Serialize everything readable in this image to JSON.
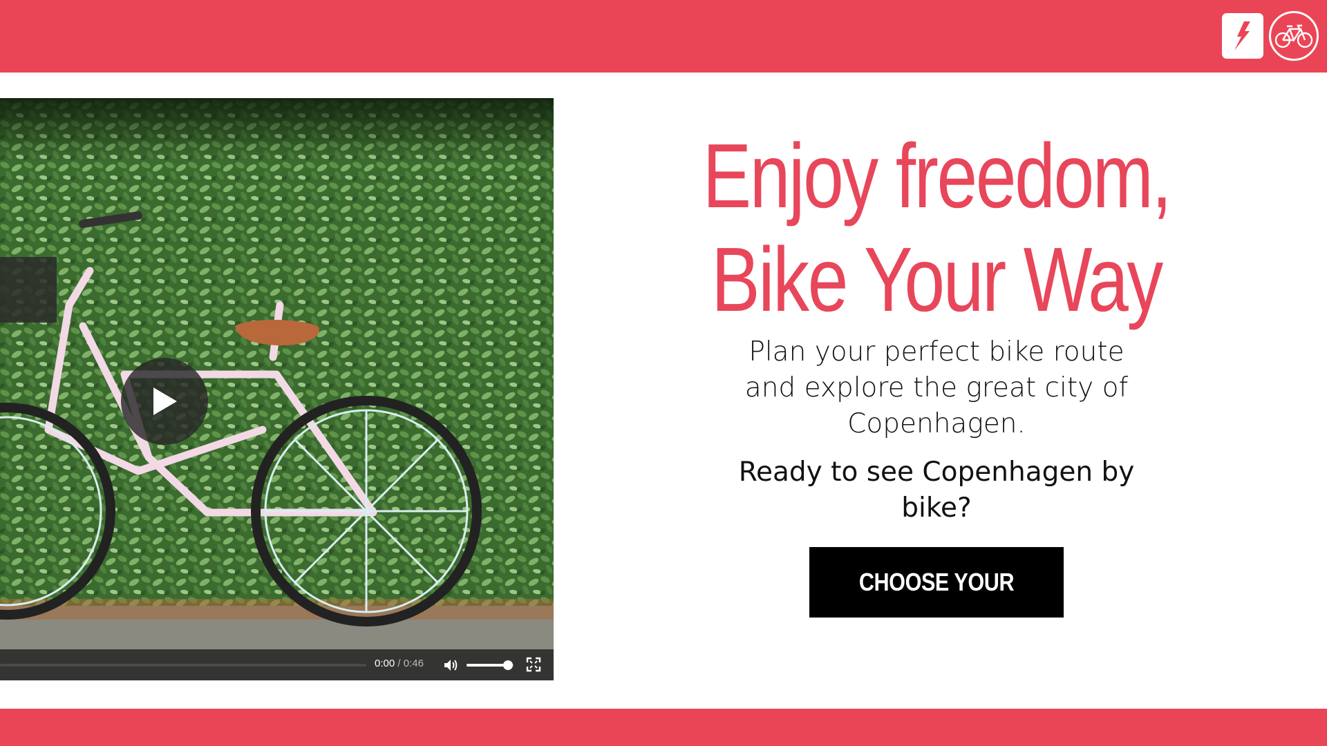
{
  "header": {
    "logo_icon": "brand-slash-logo-icon",
    "bike_icon": "bicycle-icon",
    "accent_color": "#ea4556"
  },
  "video": {
    "current_time": "0:00",
    "separator": "/",
    "duration": "0:46",
    "progress": 0,
    "volume": 0.88,
    "play_icon": "play-icon",
    "volume_icon": "volume-icon",
    "fullscreen_icon": "fullscreen-icon"
  },
  "hero": {
    "title_line1": "Enjoy freedom,",
    "title_line2": "Bike Your Way",
    "description": "Plan your perfect bike route and explore the great city of Copenhagen.",
    "question": "Ready to see Copenhagen by bike?",
    "cta_label": "CHOOSE YOUR ROUTES"
  }
}
